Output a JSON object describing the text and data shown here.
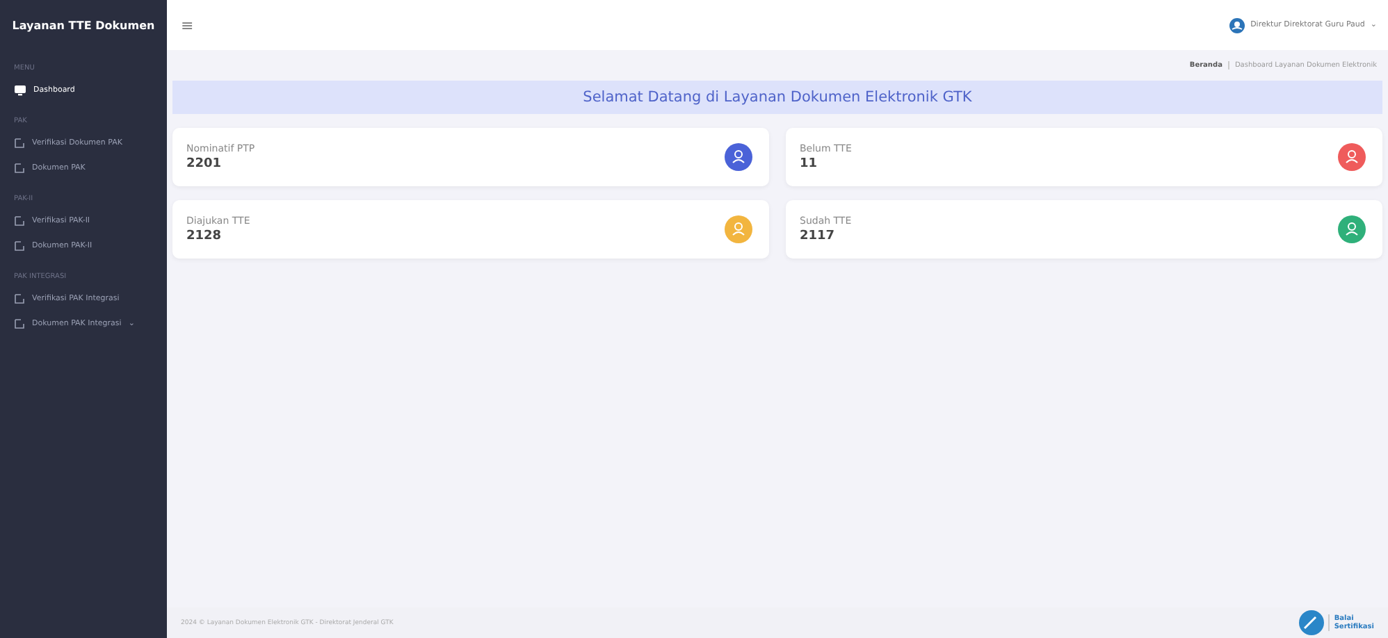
{
  "sidebar": {
    "title": "Layanan TTE Dokumen",
    "sections": [
      {
        "heading": "MENU",
        "items": [
          {
            "label": "Dashboard",
            "kind": "monitor",
            "selected": true
          }
        ]
      },
      {
        "heading": "PAK",
        "items": [
          {
            "label": "Verifikasi Dokumen PAK",
            "kind": "edit",
            "selected": false
          },
          {
            "label": "Dokumen PAK",
            "kind": "edit",
            "selected": false
          }
        ]
      },
      {
        "heading": "PAK-II",
        "items": [
          {
            "label": "Verifikasi PAK-II",
            "kind": "edit",
            "selected": false
          },
          {
            "label": "Dokumen PAK-II",
            "kind": "edit",
            "selected": false
          }
        ]
      },
      {
        "heading": "PAK INTEGRASI",
        "items": [
          {
            "label": "Verifikasi PAK Integrasi",
            "kind": "edit",
            "selected": false
          },
          {
            "label": "Dokumen PAK Integrasi",
            "kind": "edit",
            "selected": false,
            "caret": "⌄"
          }
        ]
      }
    ]
  },
  "topbar": {
    "menu_glyph": "≡",
    "user": "Direktur Direktorat Guru Paud",
    "caret": "⌄"
  },
  "breadcrumb": [
    "Beranda",
    "Dashboard Layanan Dokumen Elektronik"
  ],
  "banner": "Selamat Datang di Layanan Dokumen Elektronik GTK",
  "cards": [
    {
      "label": "Nominatif PTP",
      "value": "2201",
      "color": "#4a62d8"
    },
    {
      "label": "Belum TTE",
      "value": "11",
      "color": "#ef5b5b"
    },
    {
      "label": "Diajukan TTE",
      "value": "2128",
      "color": "#f2b53f"
    },
    {
      "label": "Sudah TTE",
      "value": "2117",
      "color": "#2fb07a"
    }
  ],
  "footer": {
    "text": "2024 © Layanan Dokumen Elektronik GTK - Direktorat Jenderal GTK",
    "logo": [
      "Balai",
      "Sertifikasi"
    ]
  }
}
